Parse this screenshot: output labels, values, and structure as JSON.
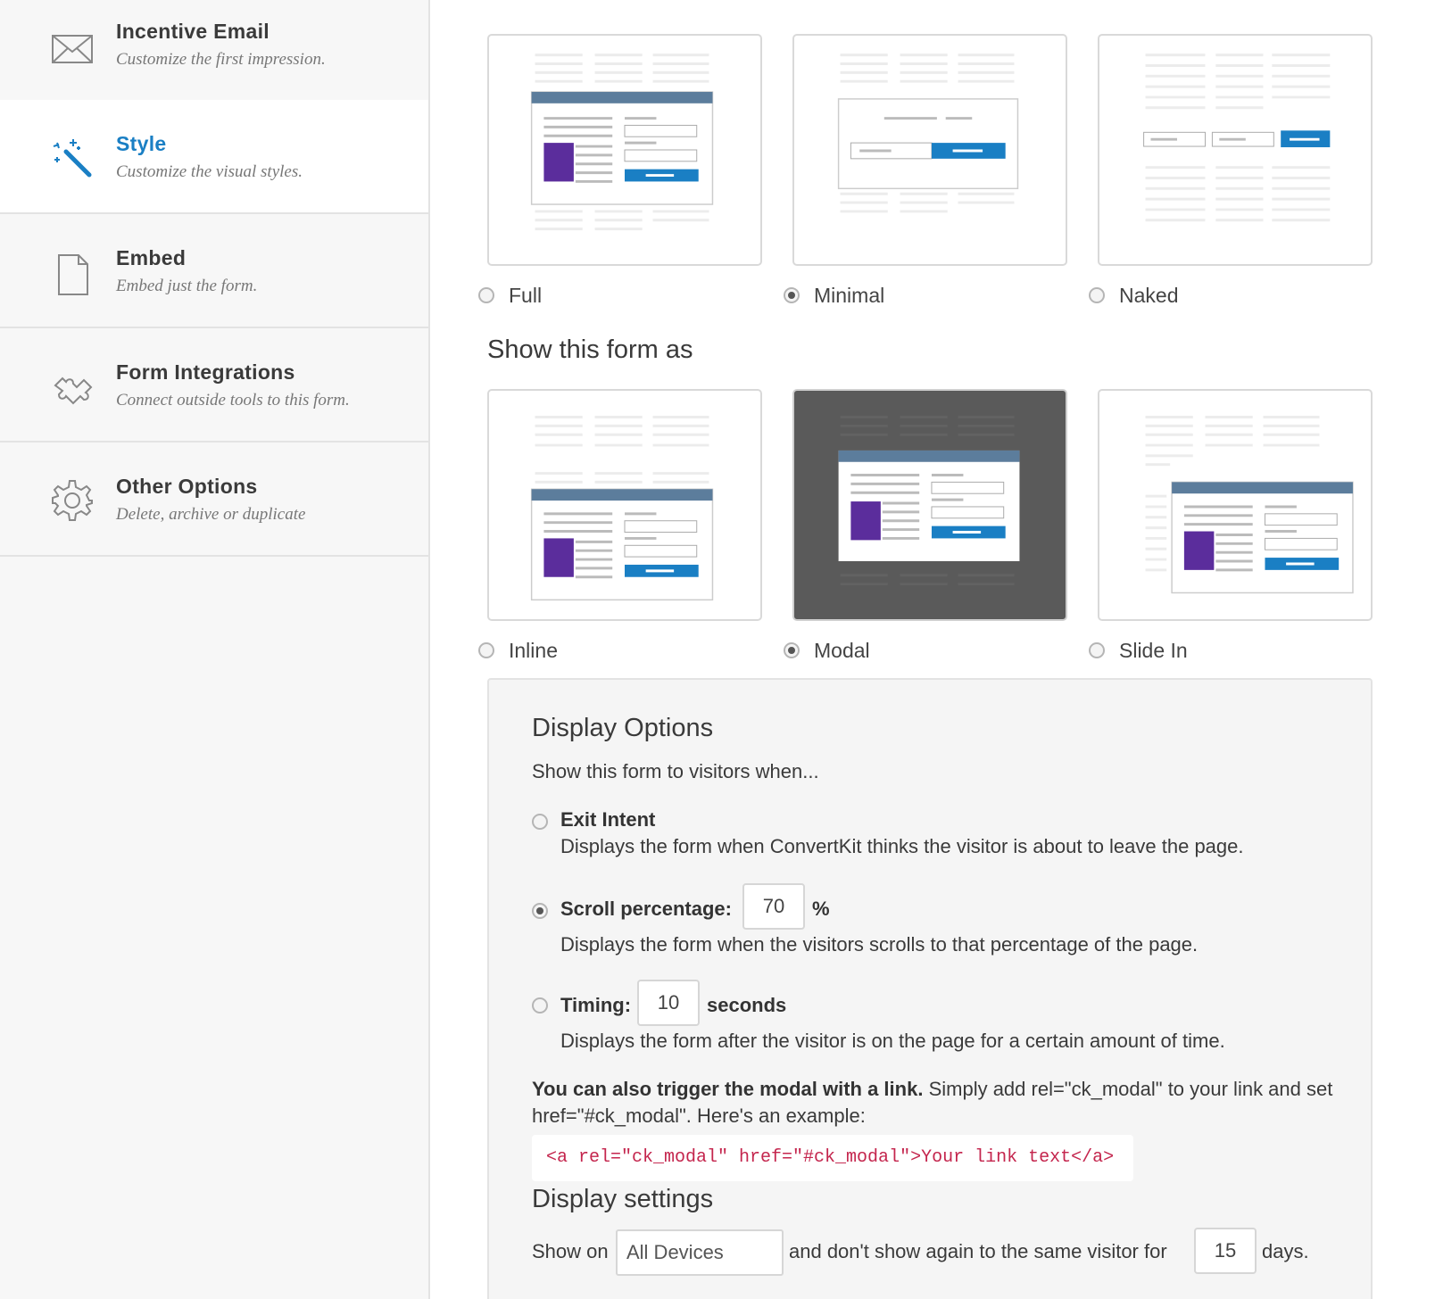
{
  "sidebar": {
    "items": [
      {
        "title": "Incentive Email",
        "subtitle": "Customize the first impression.",
        "icon": "envelope-icon",
        "active": false
      },
      {
        "title": "Style",
        "subtitle": "Customize the visual styles.",
        "icon": "magic-wand-icon",
        "active": true
      },
      {
        "title": "Embed",
        "subtitle": "Embed just the form.",
        "icon": "document-icon",
        "active": false
      },
      {
        "title": "Form Integrations",
        "subtitle": "Connect outside tools to this form.",
        "icon": "puzzle-icon",
        "active": false
      },
      {
        "title": "Other Options",
        "subtitle": "Delete, archive or duplicate",
        "icon": "gear-icon",
        "active": false
      }
    ]
  },
  "layout_options": [
    {
      "label": "Full",
      "selected": false
    },
    {
      "label": "Minimal",
      "selected": true
    },
    {
      "label": "Naked",
      "selected": false
    }
  ],
  "show_as": {
    "heading": "Show this form as",
    "options": [
      {
        "label": "Inline",
        "selected": false
      },
      {
        "label": "Modal",
        "selected": true
      },
      {
        "label": "Slide In",
        "selected": false
      }
    ]
  },
  "display_options": {
    "heading": "Display Options",
    "intro": "Show this form to visitors when...",
    "exit_intent": {
      "title": "Exit Intent",
      "desc": "Displays the form when ConvertKit thinks the visitor is about to leave the page.",
      "selected": false
    },
    "scroll": {
      "title": "Scroll percentage:",
      "value": "70",
      "unit": "%",
      "desc": "Displays the form when the visitors scrolls to that percentage of the page.",
      "selected": true
    },
    "timing": {
      "title": "Timing:",
      "value": "10",
      "unit": "seconds",
      "desc": "Displays the form after the visitor is on the page for a certain amount of time.",
      "selected": false
    },
    "trigger_bold": "You can also trigger the modal with a link.",
    "trigger_rest": " Simply add rel=\"ck_modal\" to your link and set href=\"#ck_modal\". Here's an example:",
    "code_example": "<a rel=\"ck_modal\" href=\"#ck_modal\">Your link text</a>"
  },
  "display_settings": {
    "heading": "Display settings",
    "show_on_label": "Show on",
    "device": "All Devices",
    "middle_text": "and don't show again to the same visitor for",
    "days_value": "15",
    "days_label": "days."
  },
  "colors": {
    "accent": "#1a7fc4",
    "purple": "#5b2d9c",
    "header_bar": "#5c7d9c",
    "button_blue": "#1a7fc4",
    "modal_bg": "#5a5a5a",
    "code": "#c4254d"
  }
}
